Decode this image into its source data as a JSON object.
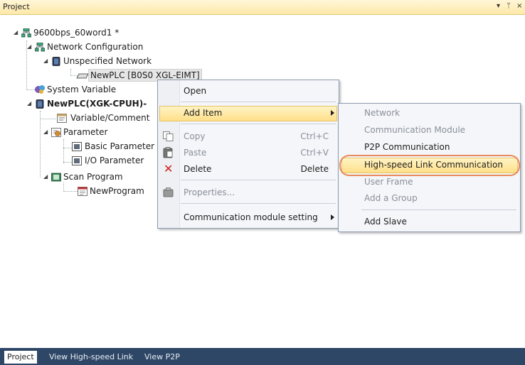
{
  "panel": {
    "title": "Project",
    "dropdown_icon": "▾",
    "pin_icon": "ᛘ",
    "close_icon": "×"
  },
  "tree": {
    "project": "9600bps_60word1 *",
    "network_config": "Network Configuration",
    "unspecified_network": "Unspecified Network",
    "newplc_net": "NewPLC [B0S0 XGL-EIMT]",
    "system_variable": "System Variable",
    "newplc": "NewPLC(XGK-CPUH)-",
    "variable_comment": "Variable/Comment",
    "parameter": "Parameter",
    "basic_parameter": "Basic Parameter",
    "io_parameter": "I/O Parameter",
    "scan_program": "Scan Program",
    "new_program": "NewProgram"
  },
  "context_menu": {
    "open": "Open",
    "add_item": "Add Item",
    "copy": "Copy",
    "copy_sc": "Ctrl+C",
    "paste": "Paste",
    "paste_sc": "Ctrl+V",
    "delete": "Delete",
    "delete_sc": "Delete",
    "properties": "Properties...",
    "comm_setting": "Communication module setting"
  },
  "submenu": {
    "network": "Network",
    "comm_module": "Communication Module",
    "p2p": "P2P Communication",
    "highspeed": "High-speed Link Communication",
    "user_frame": "User Frame",
    "add_group": "Add a Group",
    "add_slave": "Add Slave"
  },
  "bottom_tabs": {
    "project": "Project",
    "view_hs": "View High-speed Link",
    "view_p2p": "View P2P"
  }
}
